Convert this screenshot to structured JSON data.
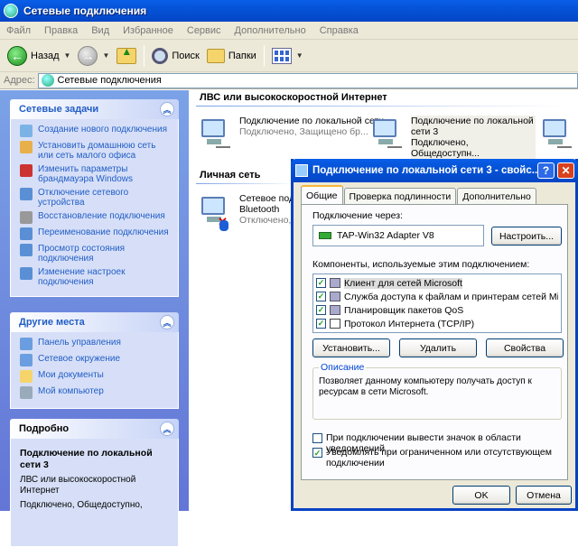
{
  "window": {
    "title": "Сетевые подключения"
  },
  "menu": [
    "Файл",
    "Правка",
    "Вид",
    "Избранное",
    "Сервис",
    "Дополнительно",
    "Справка"
  ],
  "toolbar": {
    "back": "Назад",
    "search": "Поиск",
    "folders": "Папки"
  },
  "address": {
    "label": "Адрес:",
    "value": "Сетевые подключения"
  },
  "left": {
    "tasks": {
      "title": "Сетевые задачи",
      "items": [
        "Создание нового подключения",
        "Установить домашнюю сеть или сеть малого офиса",
        "Изменить параметры брандмауэра Windows",
        "Отключение сетевого устройства",
        "Восстановление подключения",
        "Переименование подключения",
        "Просмотр состояния подключения",
        "Изменение настроек подключения"
      ]
    },
    "places": {
      "title": "Другие места",
      "items": [
        "Панель управления",
        "Сетевое окружение",
        "Мои документы",
        "Мой компьютер"
      ]
    },
    "details": {
      "title": "Подробно",
      "name": "Подключение по локальной сети 3",
      "type": "ЛВС или высокоскоростной Интернет",
      "status": "Подключено, Общедоступно,"
    }
  },
  "content": {
    "group1": "ЛВС или высокоскоростной Интернет",
    "conn1": {
      "name": "Подключение по локальной сети",
      "status": "Подключено, Защищено бр..."
    },
    "conn2": {
      "name": "Подключение по локальной сети 3",
      "status": "Подключено, Общедоступн..."
    },
    "group2": "Личная сеть",
    "conn3": {
      "name": "Сетевое подк",
      "type": "Bluetooth",
      "status": "Отключено, ..."
    }
  },
  "dialog": {
    "title": "Подключение по локальной сети 3 - свойс...",
    "tabs": [
      "Общие",
      "Проверка подлинности",
      "Дополнительно"
    ],
    "connect_via": "Подключение через:",
    "adapter": "TAP-Win32 Adapter V8",
    "configure": "Настроить...",
    "components_label": "Компоненты, используемые этим подключением:",
    "components": [
      "Клиент для сетей Microsoft",
      "Служба доступа к файлам и принтерам сетей Micro...",
      "Планировщик пакетов QoS",
      "Протокол Интернета (TCP/IP)"
    ],
    "install": "Установить...",
    "remove": "Удалить",
    "properties": "Свойства",
    "desc_label": "Описание",
    "desc_text": "Позволяет данному компьютеру получать доступ к ресурсам в сети Microsoft.",
    "opt1": "При подключении вывести значок в области уведомлений",
    "opt2": "Уведомлять при ограниченном или отсутствующем подключении",
    "ok": "OK",
    "cancel": "Отмена"
  }
}
